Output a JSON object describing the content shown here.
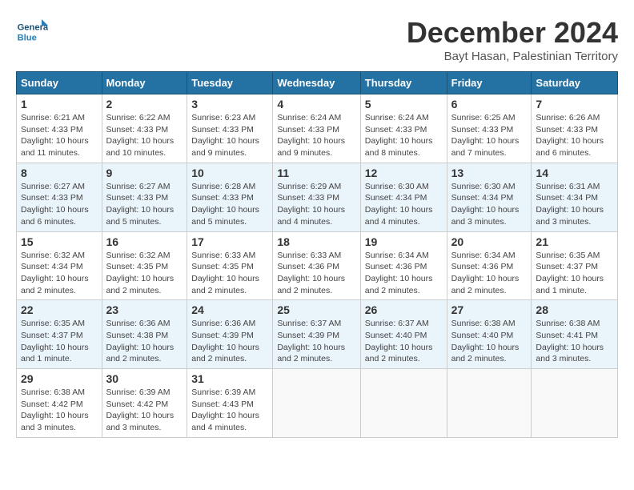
{
  "header": {
    "logo_line1": "General",
    "logo_line2": "Blue",
    "title": "December 2024",
    "subtitle": "Bayt Hasan, Palestinian Territory"
  },
  "days_of_week": [
    "Sunday",
    "Monday",
    "Tuesday",
    "Wednesday",
    "Thursday",
    "Friday",
    "Saturday"
  ],
  "weeks": [
    [
      {
        "day": 1,
        "info": "Sunrise: 6:21 AM\nSunset: 4:33 PM\nDaylight: 10 hours\nand 11 minutes."
      },
      {
        "day": 2,
        "info": "Sunrise: 6:22 AM\nSunset: 4:33 PM\nDaylight: 10 hours\nand 10 minutes."
      },
      {
        "day": 3,
        "info": "Sunrise: 6:23 AM\nSunset: 4:33 PM\nDaylight: 10 hours\nand 9 minutes."
      },
      {
        "day": 4,
        "info": "Sunrise: 6:24 AM\nSunset: 4:33 PM\nDaylight: 10 hours\nand 9 minutes."
      },
      {
        "day": 5,
        "info": "Sunrise: 6:24 AM\nSunset: 4:33 PM\nDaylight: 10 hours\nand 8 minutes."
      },
      {
        "day": 6,
        "info": "Sunrise: 6:25 AM\nSunset: 4:33 PM\nDaylight: 10 hours\nand 7 minutes."
      },
      {
        "day": 7,
        "info": "Sunrise: 6:26 AM\nSunset: 4:33 PM\nDaylight: 10 hours\nand 6 minutes."
      }
    ],
    [
      {
        "day": 8,
        "info": "Sunrise: 6:27 AM\nSunset: 4:33 PM\nDaylight: 10 hours\nand 6 minutes."
      },
      {
        "day": 9,
        "info": "Sunrise: 6:27 AM\nSunset: 4:33 PM\nDaylight: 10 hours\nand 5 minutes."
      },
      {
        "day": 10,
        "info": "Sunrise: 6:28 AM\nSunset: 4:33 PM\nDaylight: 10 hours\nand 5 minutes."
      },
      {
        "day": 11,
        "info": "Sunrise: 6:29 AM\nSunset: 4:33 PM\nDaylight: 10 hours\nand 4 minutes."
      },
      {
        "day": 12,
        "info": "Sunrise: 6:30 AM\nSunset: 4:34 PM\nDaylight: 10 hours\nand 4 minutes."
      },
      {
        "day": 13,
        "info": "Sunrise: 6:30 AM\nSunset: 4:34 PM\nDaylight: 10 hours\nand 3 minutes."
      },
      {
        "day": 14,
        "info": "Sunrise: 6:31 AM\nSunset: 4:34 PM\nDaylight: 10 hours\nand 3 minutes."
      }
    ],
    [
      {
        "day": 15,
        "info": "Sunrise: 6:32 AM\nSunset: 4:34 PM\nDaylight: 10 hours\nand 2 minutes."
      },
      {
        "day": 16,
        "info": "Sunrise: 6:32 AM\nSunset: 4:35 PM\nDaylight: 10 hours\nand 2 minutes."
      },
      {
        "day": 17,
        "info": "Sunrise: 6:33 AM\nSunset: 4:35 PM\nDaylight: 10 hours\nand 2 minutes."
      },
      {
        "day": 18,
        "info": "Sunrise: 6:33 AM\nSunset: 4:36 PM\nDaylight: 10 hours\nand 2 minutes."
      },
      {
        "day": 19,
        "info": "Sunrise: 6:34 AM\nSunset: 4:36 PM\nDaylight: 10 hours\nand 2 minutes."
      },
      {
        "day": 20,
        "info": "Sunrise: 6:34 AM\nSunset: 4:36 PM\nDaylight: 10 hours\nand 2 minutes."
      },
      {
        "day": 21,
        "info": "Sunrise: 6:35 AM\nSunset: 4:37 PM\nDaylight: 10 hours\nand 1 minute."
      }
    ],
    [
      {
        "day": 22,
        "info": "Sunrise: 6:35 AM\nSunset: 4:37 PM\nDaylight: 10 hours\nand 1 minute."
      },
      {
        "day": 23,
        "info": "Sunrise: 6:36 AM\nSunset: 4:38 PM\nDaylight: 10 hours\nand 2 minutes."
      },
      {
        "day": 24,
        "info": "Sunrise: 6:36 AM\nSunset: 4:39 PM\nDaylight: 10 hours\nand 2 minutes."
      },
      {
        "day": 25,
        "info": "Sunrise: 6:37 AM\nSunset: 4:39 PM\nDaylight: 10 hours\nand 2 minutes."
      },
      {
        "day": 26,
        "info": "Sunrise: 6:37 AM\nSunset: 4:40 PM\nDaylight: 10 hours\nand 2 minutes."
      },
      {
        "day": 27,
        "info": "Sunrise: 6:38 AM\nSunset: 4:40 PM\nDaylight: 10 hours\nand 2 minutes."
      },
      {
        "day": 28,
        "info": "Sunrise: 6:38 AM\nSunset: 4:41 PM\nDaylight: 10 hours\nand 3 minutes."
      }
    ],
    [
      {
        "day": 29,
        "info": "Sunrise: 6:38 AM\nSunset: 4:42 PM\nDaylight: 10 hours\nand 3 minutes."
      },
      {
        "day": 30,
        "info": "Sunrise: 6:39 AM\nSunset: 4:42 PM\nDaylight: 10 hours\nand 3 minutes."
      },
      {
        "day": 31,
        "info": "Sunrise: 6:39 AM\nSunset: 4:43 PM\nDaylight: 10 hours\nand 4 minutes."
      },
      null,
      null,
      null,
      null
    ]
  ]
}
